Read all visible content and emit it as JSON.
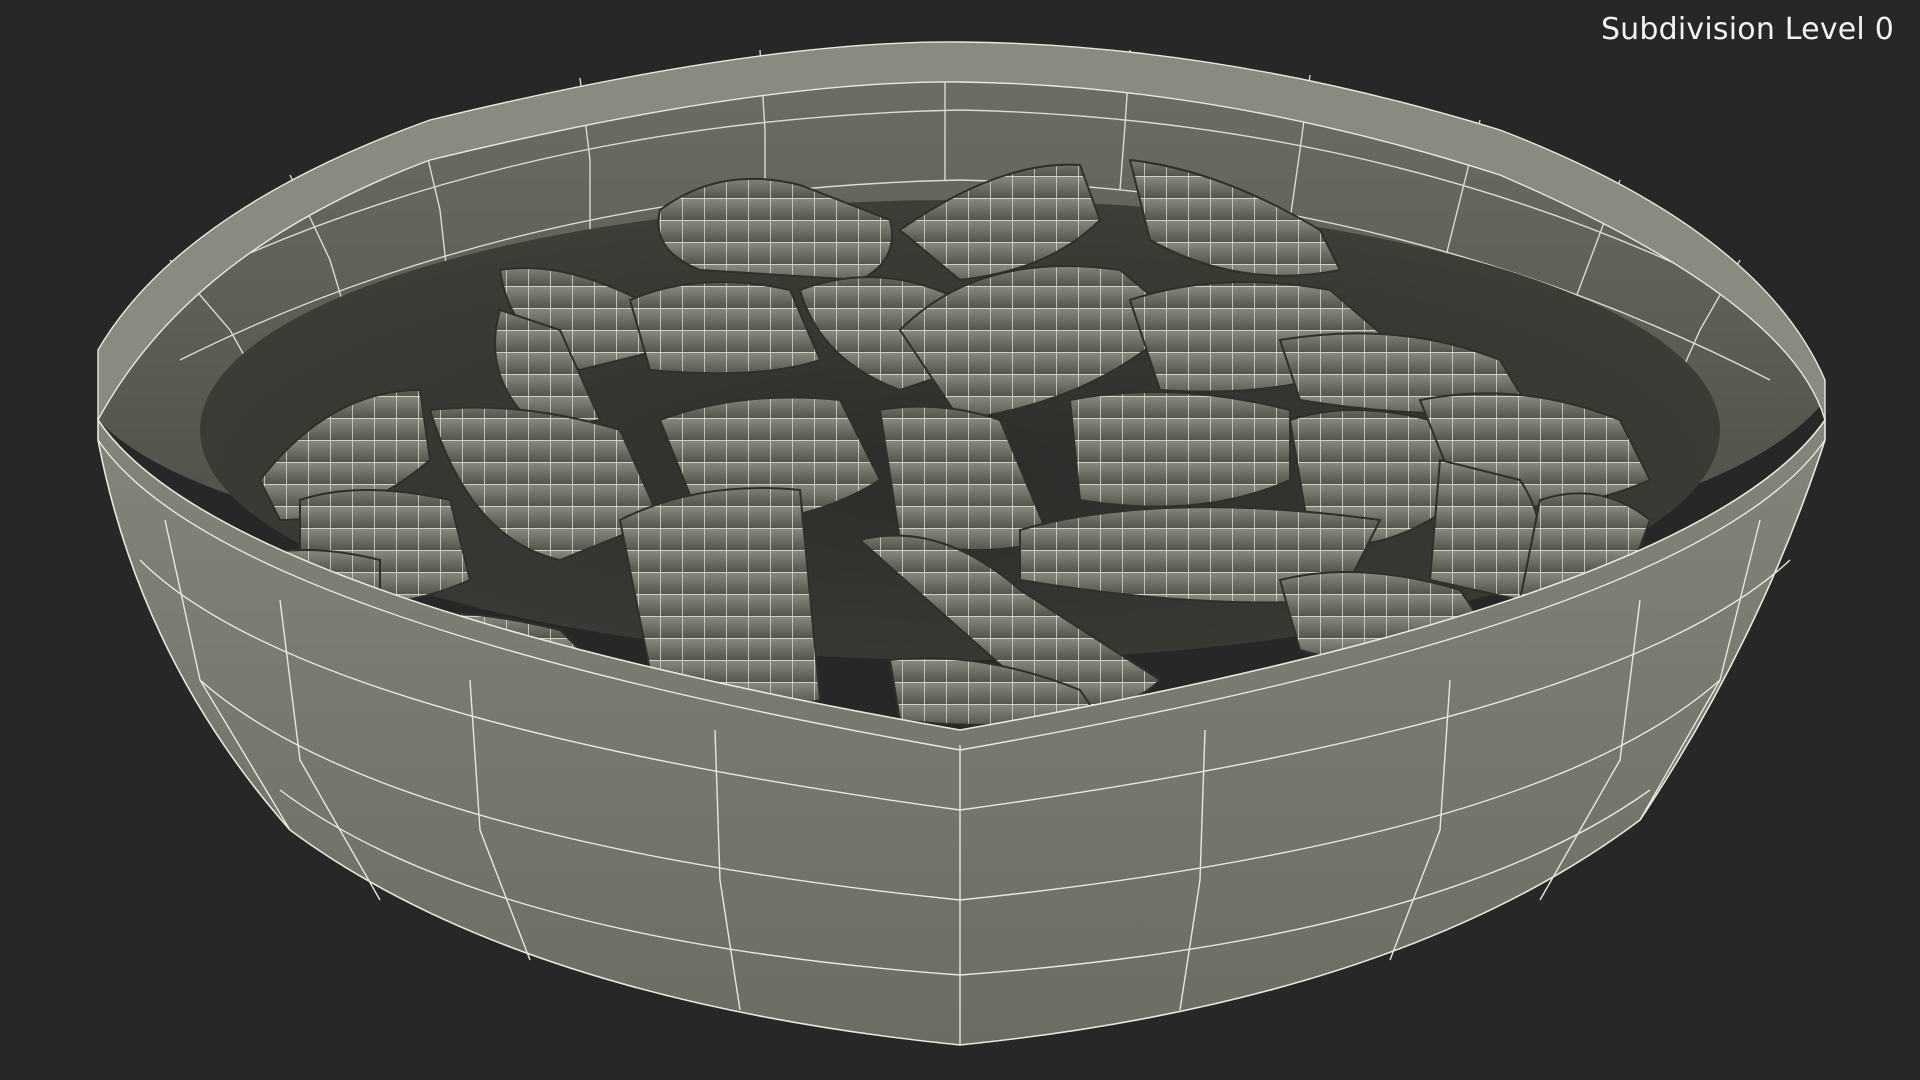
{
  "viewport": {
    "label": "Subdivision Level 0"
  },
  "render": {
    "subject": "bowl-of-pillow-cereal-wireframe",
    "background_color": "#272727",
    "mesh_color": "#7e7e72",
    "wire_color": "#e8e8dc"
  }
}
